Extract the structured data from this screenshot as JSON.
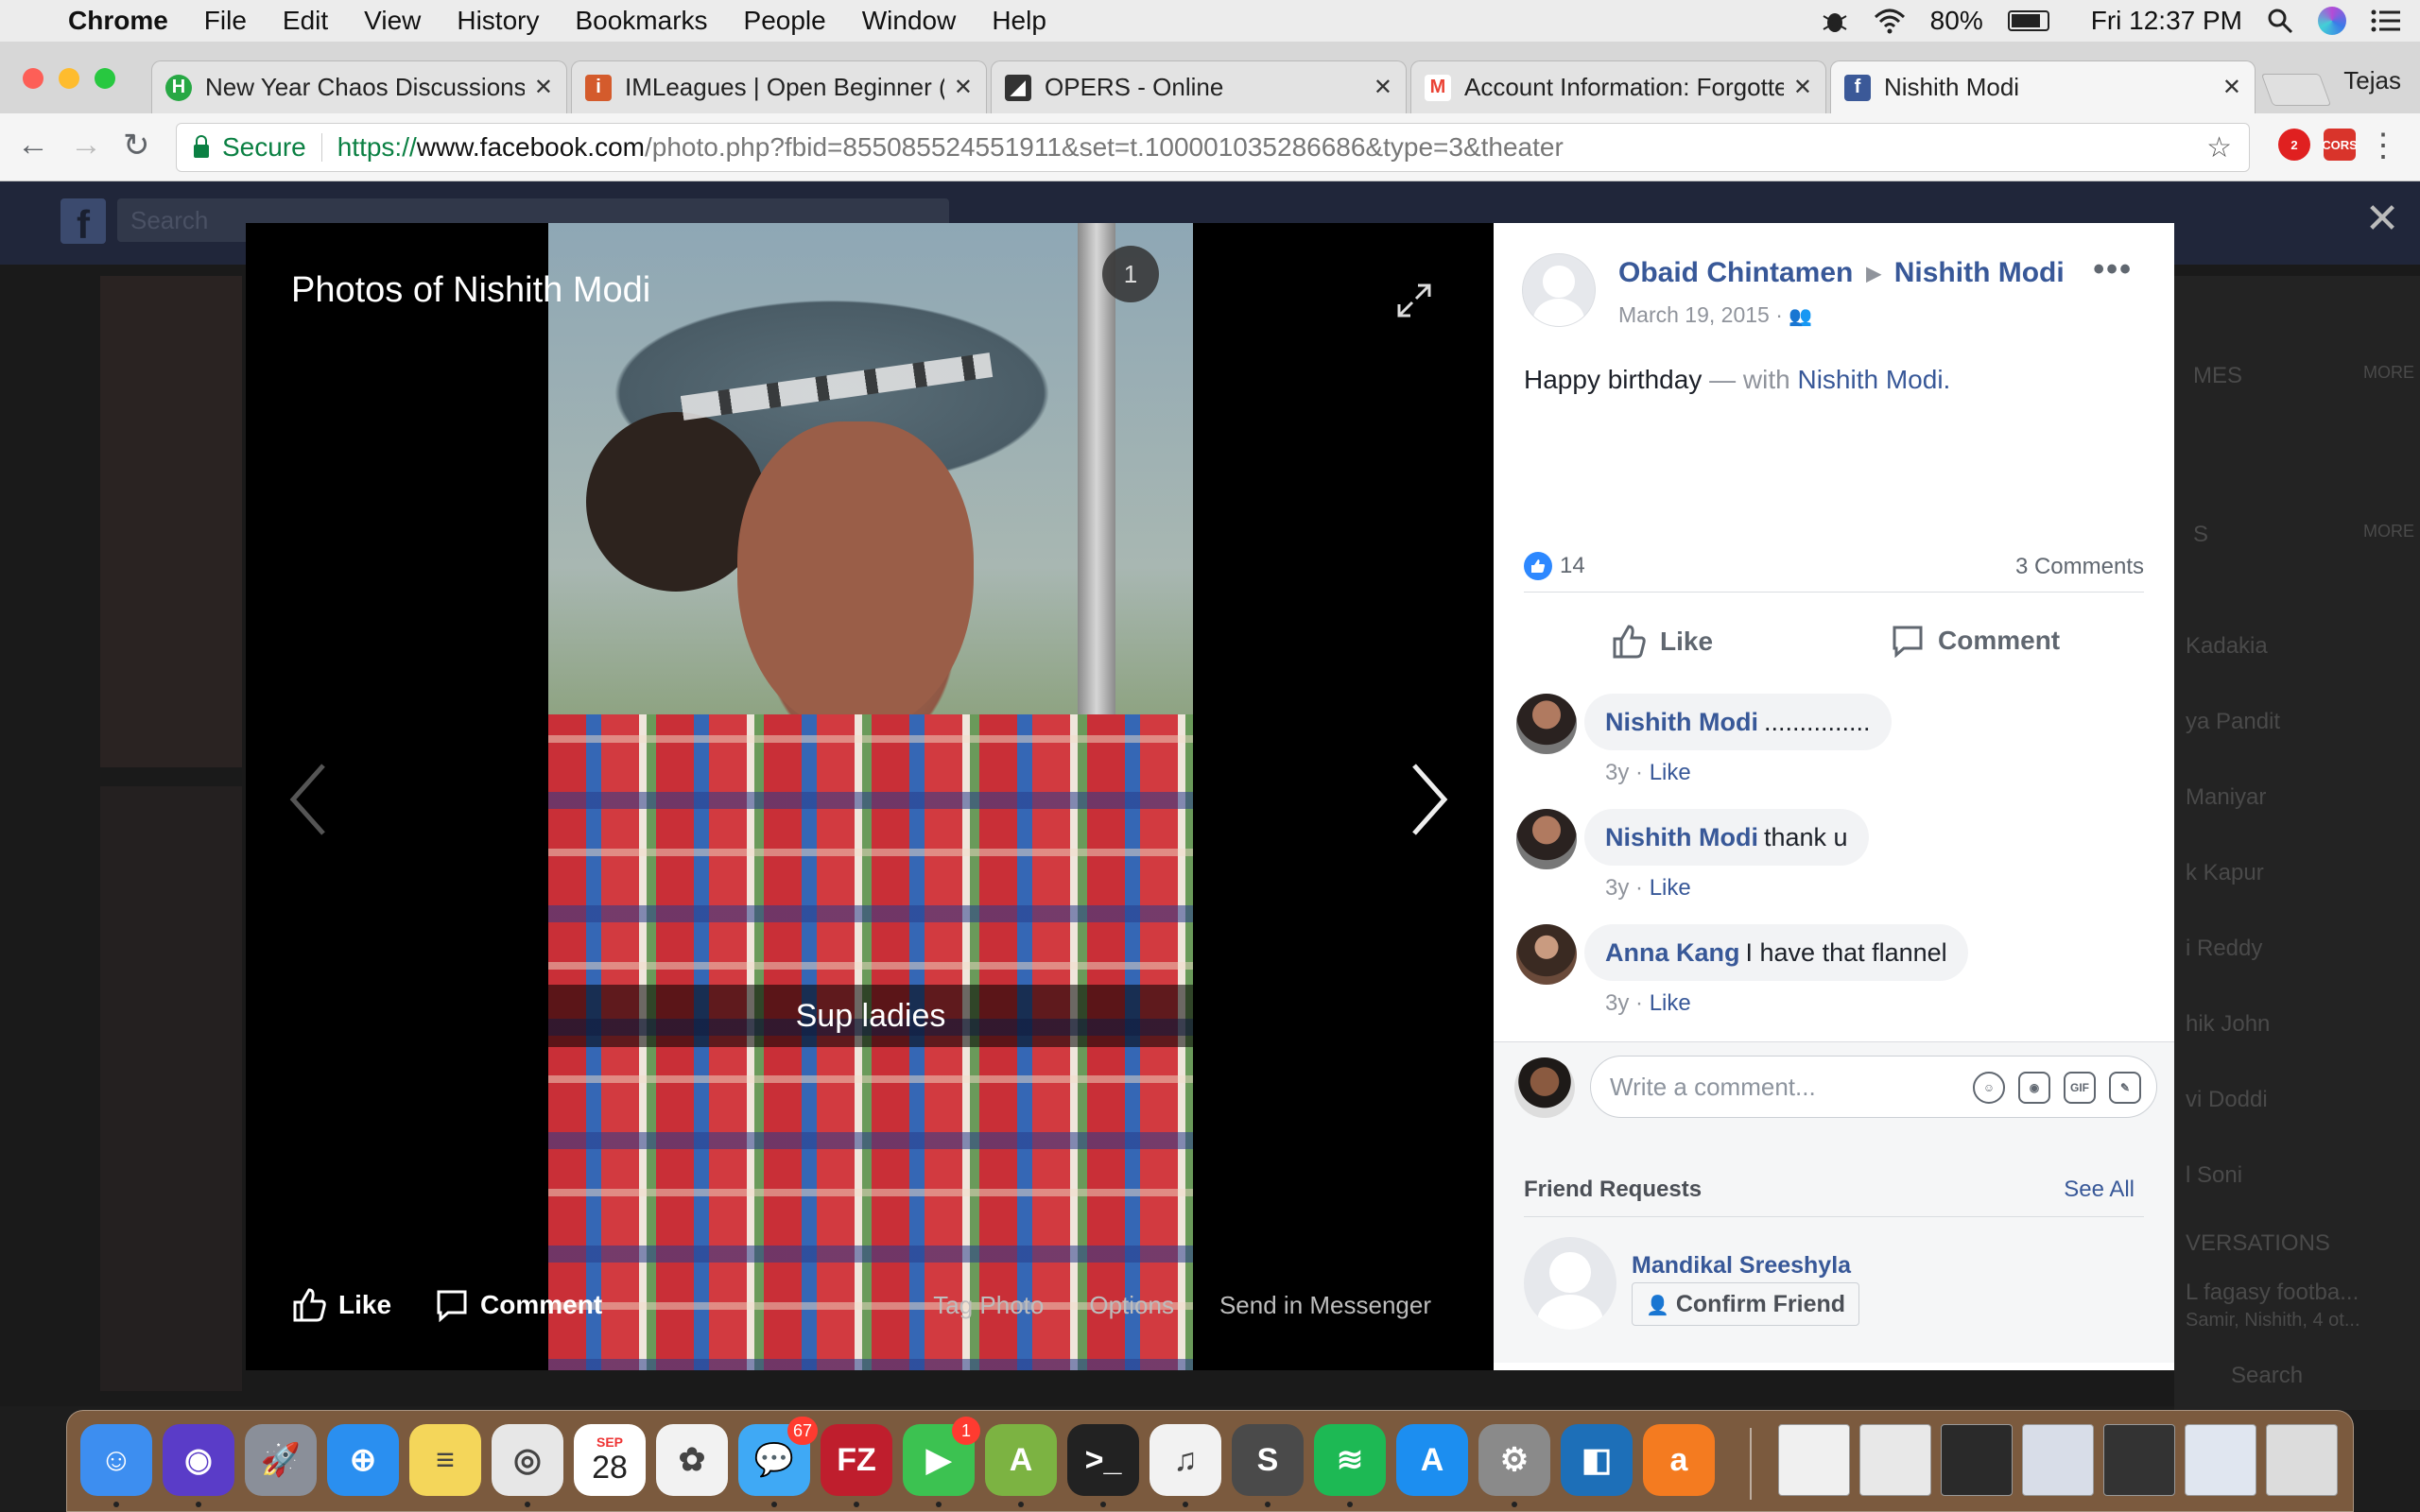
{
  "menubar": {
    "app_name": "Chrome",
    "items": [
      "File",
      "Edit",
      "View",
      "History",
      "Bookmarks",
      "People",
      "Window",
      "Help"
    ],
    "battery_percent": "80%",
    "clock": "Fri 12:37 PM"
  },
  "tabs": [
    {
      "title": "New Year Chaos Discussions",
      "favicon": "hackmd-icon",
      "color": "#27a844",
      "glyph": "H"
    },
    {
      "title": "IMLeagues | Open Beginner (U",
      "favicon": "imleagues-icon",
      "color": "#d45b2c",
      "glyph": "i"
    },
    {
      "title": "OPERS - Online",
      "favicon": "opers-icon",
      "color": "#333333",
      "glyph": "◢"
    },
    {
      "title": "Account Information: Forgotte",
      "favicon": "gmail-icon",
      "color": "#ea4335",
      "glyph": "M"
    },
    {
      "title": "Nishith Modi",
      "favicon": "facebook-icon",
      "color": "#3b5998",
      "glyph": "f",
      "active": true
    }
  ],
  "profile_name": "Tejas",
  "address": {
    "security_label": "Secure",
    "scheme": "https://",
    "host": "www.facebook.com",
    "path": "/photo.php?fbid=855085524551911&set=t.100001035286686&type=3&theater"
  },
  "extensions": [
    {
      "name": "extension-badge-icon",
      "label": "2",
      "color": "#e02020"
    },
    {
      "name": "cors-extension-icon",
      "label": "CORS",
      "color": "#d9342b"
    }
  ],
  "fb_background": {
    "search_placeholder": "Search",
    "right_column": [
      "MES",
      "MORE",
      "S",
      "MORE",
      "Kadakia",
      "ya Pandit",
      "Maniyar",
      "k Kapur",
      "i Reddy",
      "hik John",
      "vi Doddi",
      "l Soni",
      "VERSATIONS",
      "L fagasy footba...",
      "Samir, Nishith, 4 ot...",
      "Search"
    ]
  },
  "theater": {
    "title": "Photos of Nishith Modi",
    "snap_caption": "Sup ladies",
    "snap_badge": "1",
    "actions": {
      "like": "Like",
      "comment": "Comment"
    },
    "links": [
      "Tag Photo",
      "Options",
      "Send in Messenger"
    ]
  },
  "post": {
    "author": "Obaid Chintamen",
    "target": "Nishith Modi",
    "date": "March 19, 2015 ·",
    "text": "Happy birthday",
    "with_label": "— with",
    "with_name": "Nishith Modi.",
    "like_count": "14",
    "comments_count": "3 Comments",
    "like_button": "Like",
    "comment_button": "Comment"
  },
  "comments": [
    {
      "author": "Nishith Modi",
      "text": "...............",
      "age": "3y ·",
      "like": "Like"
    },
    {
      "author": "Nishith Modi",
      "text": "thank u",
      "age": "3y ·",
      "like": "Like"
    },
    {
      "author": "Anna Kang",
      "text": "I have that flannel",
      "age": "3y ·",
      "like": "Like"
    }
  ],
  "composer": {
    "placeholder": "Write a comment...",
    "gif_label": "GIF"
  },
  "friend_requests": {
    "heading": "Friend Requests",
    "see_all": "See All",
    "name": "Mandikal Sreeshyla",
    "confirm": "Confirm Friend"
  },
  "dock": {
    "calendar_month": "SEP",
    "calendar_day": "28",
    "messages_badge": "67",
    "facetime_badge": "1",
    "apps": [
      {
        "name": "finder-icon",
        "color": "#3d8ef0",
        "glyph": "☺"
      },
      {
        "name": "siri-icon",
        "color": "#5a3cc8",
        "glyph": "◉"
      },
      {
        "name": "launchpad-icon",
        "color": "#8a8f99",
        "glyph": "🚀"
      },
      {
        "name": "safari-icon",
        "color": "#2a8ff0",
        "glyph": "⊕"
      },
      {
        "name": "notes-icon",
        "color": "#f4d65a",
        "glyph": "≡"
      },
      {
        "name": "chrome-icon",
        "color": "#e7e7e7",
        "glyph": "◎"
      },
      {
        "name": "calendar-icon",
        "color": "#ffffff",
        "glyph": ""
      },
      {
        "name": "photos-icon",
        "color": "#f2f2f2",
        "glyph": "✿"
      },
      {
        "name": "messages-icon",
        "color": "#3fa9f5",
        "glyph": "💬"
      },
      {
        "name": "filezilla-icon",
        "color": "#bf1e2d",
        "glyph": "FZ"
      },
      {
        "name": "facetime-icon",
        "color": "#3cc251",
        "glyph": "▶"
      },
      {
        "name": "android-studio-icon",
        "color": "#7cb342",
        "glyph": "A"
      },
      {
        "name": "terminal-icon",
        "color": "#222222",
        "glyph": ">_"
      },
      {
        "name": "itunes-icon",
        "color": "#f2f2f2",
        "glyph": "♫"
      },
      {
        "name": "sublime-icon",
        "color": "#4a4a4a",
        "glyph": "S"
      },
      {
        "name": "spotify-icon",
        "color": "#1db954",
        "glyph": "≋"
      },
      {
        "name": "app-store-icon",
        "color": "#1c8ef0",
        "glyph": "A"
      },
      {
        "name": "system-preferences-icon",
        "color": "#8a8a8a",
        "glyph": "⚙"
      },
      {
        "name": "framer-icon",
        "color": "#1d6fb8",
        "glyph": "◧"
      },
      {
        "name": "avast-icon",
        "color": "#f47b20",
        "glyph": "a"
      }
    ],
    "docs": [
      {
        "name": "pdf-document-icon",
        "color": "#f0f0f0"
      },
      {
        "name": "screenshot-thumbnail-1",
        "color": "#e8e8e8"
      },
      {
        "name": "screenshot-thumbnail-2",
        "color": "#2a2a2a"
      },
      {
        "name": "screenshot-thumbnail-3",
        "color": "#d8dde8"
      },
      {
        "name": "screenshot-thumbnail-4",
        "color": "#333333"
      },
      {
        "name": "screenshot-thumbnail-5",
        "color": "#e0e6f0"
      },
      {
        "name": "trash-icon",
        "color": "#dcdcdc"
      }
    ]
  }
}
